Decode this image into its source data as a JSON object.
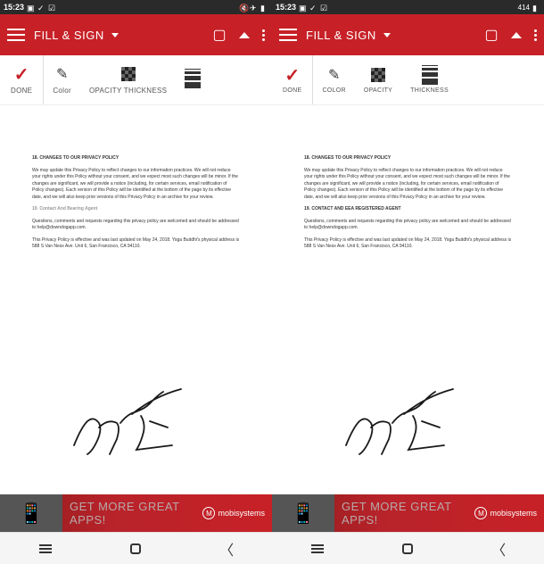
{
  "status": {
    "time": "15:23",
    "battery_right": "414"
  },
  "appbar": {
    "title": "FILL & SIGN"
  },
  "tools": {
    "done": "DONE",
    "color_left": "Color",
    "color_right": "COLOR",
    "opacity": "OPACITY",
    "thickness": "THICKNESS",
    "opacity_thickness_combined": "OPACITY THICKNESS"
  },
  "document": {
    "heading_18": "18. CHANGES TO OUR PRIVACY POLICY",
    "para_18": "We may update this Privacy Policy to reflect changes to our information practices. We will not reduce your rights under this Policy without your consent, and we expect most such changes will be minor. If the changes are significant, we will provide a notice (including, for certain services, email notification of Policy changes). Each version of this Policy will be identified at the bottom of the page by its effective date, and we will also keep prior versions of this Privacy Policy in an archive for your review.",
    "heading_19_left": "19. Contact And Bearing Agent",
    "heading_19_right": "19. CONTACT AND EEA REGISTERED AGENT",
    "para_19a": "Questions, comments and requests regarding this privacy policy are welcomed and should be addressed to help@downdogapp.com.",
    "para_19b": "This Privacy Policy is effective and was last updated on May 24, 2018. Yoga Buddhi's physical address is 588 S Van Ness Ave. Unit 6, San Francisco, CA 94110."
  },
  "ad": {
    "text": "GET MORE GREAT APPS!",
    "logo": "mobisystems"
  }
}
